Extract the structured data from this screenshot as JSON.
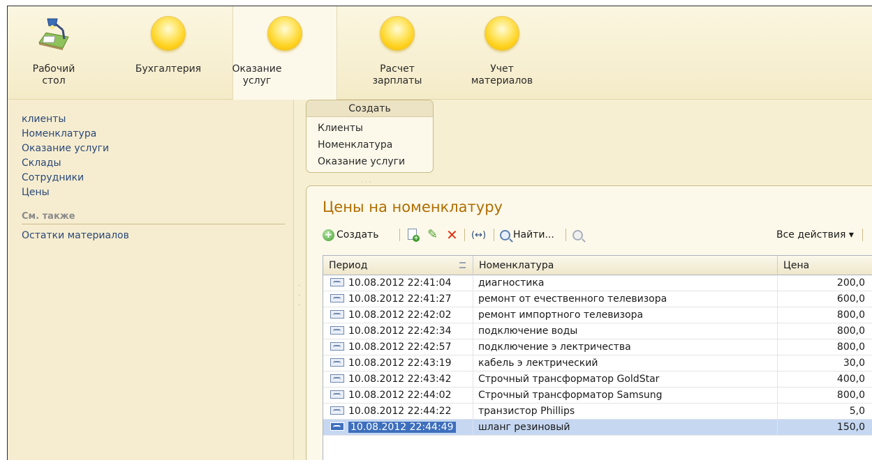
{
  "sections": [
    {
      "label": "Рабочий\nстол",
      "icon": "desktop-lamp-icon"
    },
    {
      "label": "Бухгалтерия",
      "icon": "sun-icon"
    },
    {
      "label": "Оказание\nуслуг",
      "icon": "sun-icon"
    },
    {
      "label": "Расчет\nзарплаты",
      "icon": "sun-icon"
    },
    {
      "label": "Учет\nматериалов",
      "icon": "sun-icon"
    }
  ],
  "sidebar": {
    "items": [
      "клиенты",
      "Номенклатура",
      "Оказание услуги",
      "Склады",
      "Сотрудники",
      "Цены"
    ],
    "see_also_title": "См. также",
    "see_also_items": [
      "Остатки материалов"
    ]
  },
  "create_panel": {
    "title": "Создать",
    "items": [
      "Клиенты",
      "Номенклатура",
      "Оказание услуги"
    ]
  },
  "list": {
    "title": "Цены на номенклатуру",
    "toolbar": {
      "create_label": "Создать",
      "find_label": "Найти...",
      "hscroll_label": "(↔)",
      "all_actions_label": "Все действия ▾"
    },
    "columns": {
      "period": "Период",
      "name": "Номенклатура",
      "price": "Цена"
    },
    "rows": [
      {
        "period": "10.08.2012 22:41:04",
        "name": "диагностика",
        "price": "200,0"
      },
      {
        "period": "10.08.2012 22:41:27",
        "name": "ремонт от ечественного телевизора",
        "price": "600,0"
      },
      {
        "period": "10.08.2012 22:42:02",
        "name": "ремонт импортного телевизора",
        "price": "800,0"
      },
      {
        "period": "10.08.2012 22:42:34",
        "name": "подключение воды",
        "price": "800,0"
      },
      {
        "period": "10.08.2012 22:42:57",
        "name": "подключение э лектричества",
        "price": "800,0"
      },
      {
        "period": "10.08.2012 22:43:19",
        "name": "кабель э лектрический",
        "price": "30,0"
      },
      {
        "period": "10.08.2012 22:43:42",
        "name": "Строчный трансформатор GoldStar",
        "price": "400,0"
      },
      {
        "period": "10.08.2012 22:44:02",
        "name": "Строчный трансформатор Samsung",
        "price": "800,0"
      },
      {
        "period": "10.08.2012 22:44:22",
        "name": "транзистор Phillips",
        "price": "5,0"
      },
      {
        "period": "10.08.2012 22:44:49",
        "name": "шланг резиновый",
        "price": "150,0",
        "selected": true
      }
    ]
  },
  "colors": {
    "accent_title": "#b06d00",
    "link": "#2a4878",
    "selection": "#3e6fbd",
    "background": "#f7efd2"
  }
}
